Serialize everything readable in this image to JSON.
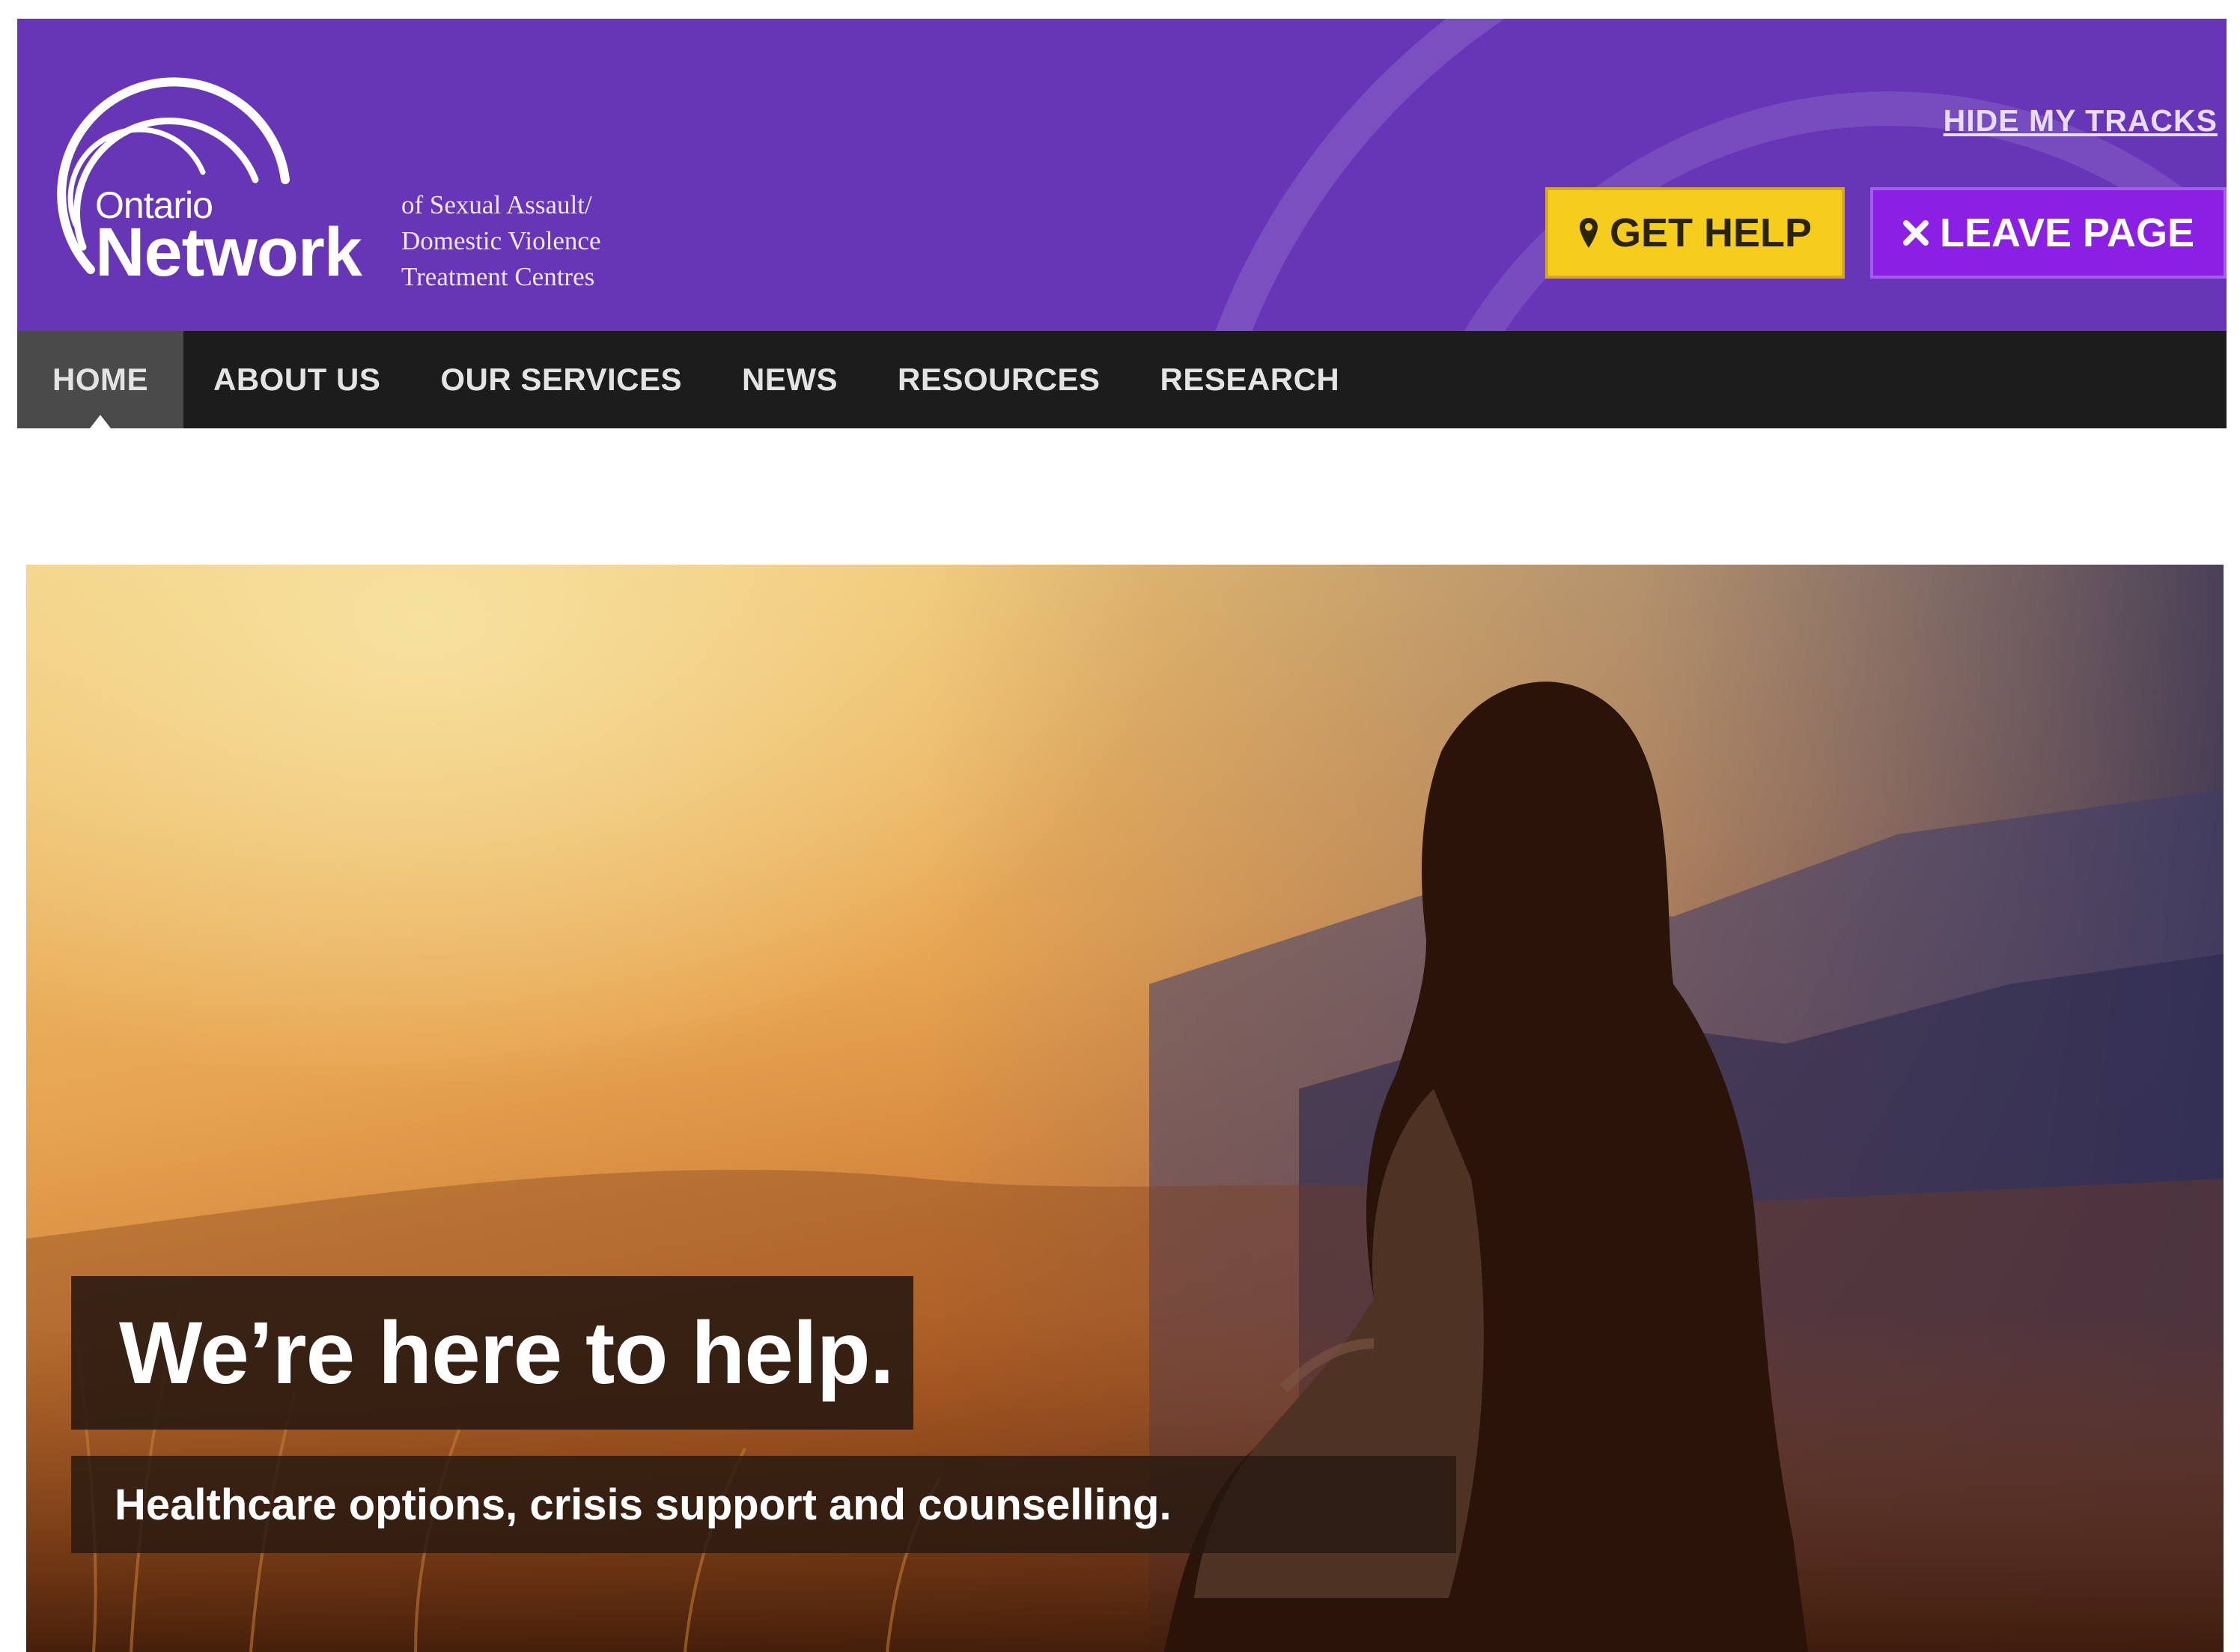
{
  "header": {
    "logo": {
      "word_small": "Ontario",
      "word_large": "Network",
      "tagline": [
        "of Sexual Assault/",
        "Domestic Violence",
        "Treatment Centres"
      ]
    },
    "hide_tracks_label": "HIDE MY TRACKS",
    "get_help": {
      "label": "GET HELP",
      "icon": "map-marker-icon"
    },
    "leave_page": {
      "label": "LEAVE PAGE",
      "icon": "close-icon"
    }
  },
  "nav": {
    "items": [
      {
        "label": "HOME",
        "active": true
      },
      {
        "label": "ABOUT US",
        "active": false
      },
      {
        "label": "OUR SERVICES",
        "active": false
      },
      {
        "label": "NEWS",
        "active": false
      },
      {
        "label": "RESOURCES",
        "active": false
      },
      {
        "label": "RESEARCH",
        "active": false
      }
    ]
  },
  "hero": {
    "title": "We’re here to help.",
    "subtitle": "Healthcare options, crisis support and counselling."
  },
  "colors": {
    "header_bg": "#6736b7",
    "nav_bg": "#1c1c1c",
    "get_help_bg": "#f6cd1d",
    "leave_page_bg": "#8b1fe4"
  }
}
